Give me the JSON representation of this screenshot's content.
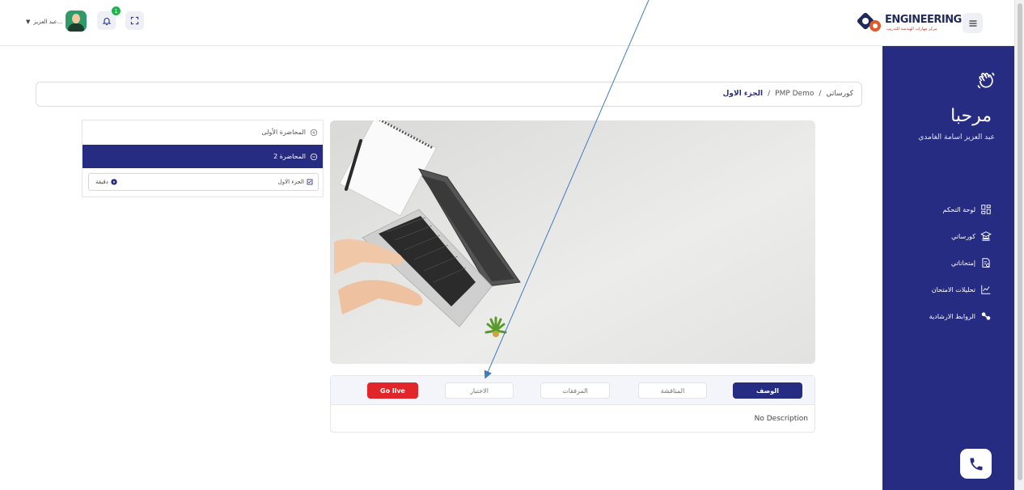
{
  "topbar": {
    "user_name": "عبد العزيز...",
    "notification_count": "1"
  },
  "logo": {
    "word": "ENGINEERING",
    "sub": "مركز مهارات الهندسة للتدريب"
  },
  "sidebar": {
    "welcome": "مرحبا",
    "username": "عبد العزيز اسامة الغامدي",
    "items": [
      {
        "label": "لوحة التحكم",
        "icon": "dashboard-icon"
      },
      {
        "label": "كورساتي",
        "icon": "courses-icon"
      },
      {
        "label": "إمتحاناتي",
        "icon": "exams-icon"
      },
      {
        "label": "تحليلات الامتحان",
        "icon": "analytics-icon"
      },
      {
        "label": "الروابط الارشادية",
        "icon": "link-icon"
      }
    ]
  },
  "breadcrumb": {
    "root": "كورساتي",
    "course": "PMP Demo",
    "current": "الجزء الاول"
  },
  "lessons": {
    "first": "المحاضرة الأولى",
    "active": "المحاضرة 2",
    "sub_title": "الجزء الاول",
    "sub_duration": "دقيقة"
  },
  "tabs": {
    "description": "الوصف",
    "discussion": "المناقشة",
    "attachments": "المرفقات",
    "exams": "الاختبار",
    "golive": "Go live"
  },
  "content": {
    "no_description": "No Description"
  },
  "colors": {
    "primary": "#272c83",
    "live": "#e0262a",
    "badge": "#22b14c"
  }
}
